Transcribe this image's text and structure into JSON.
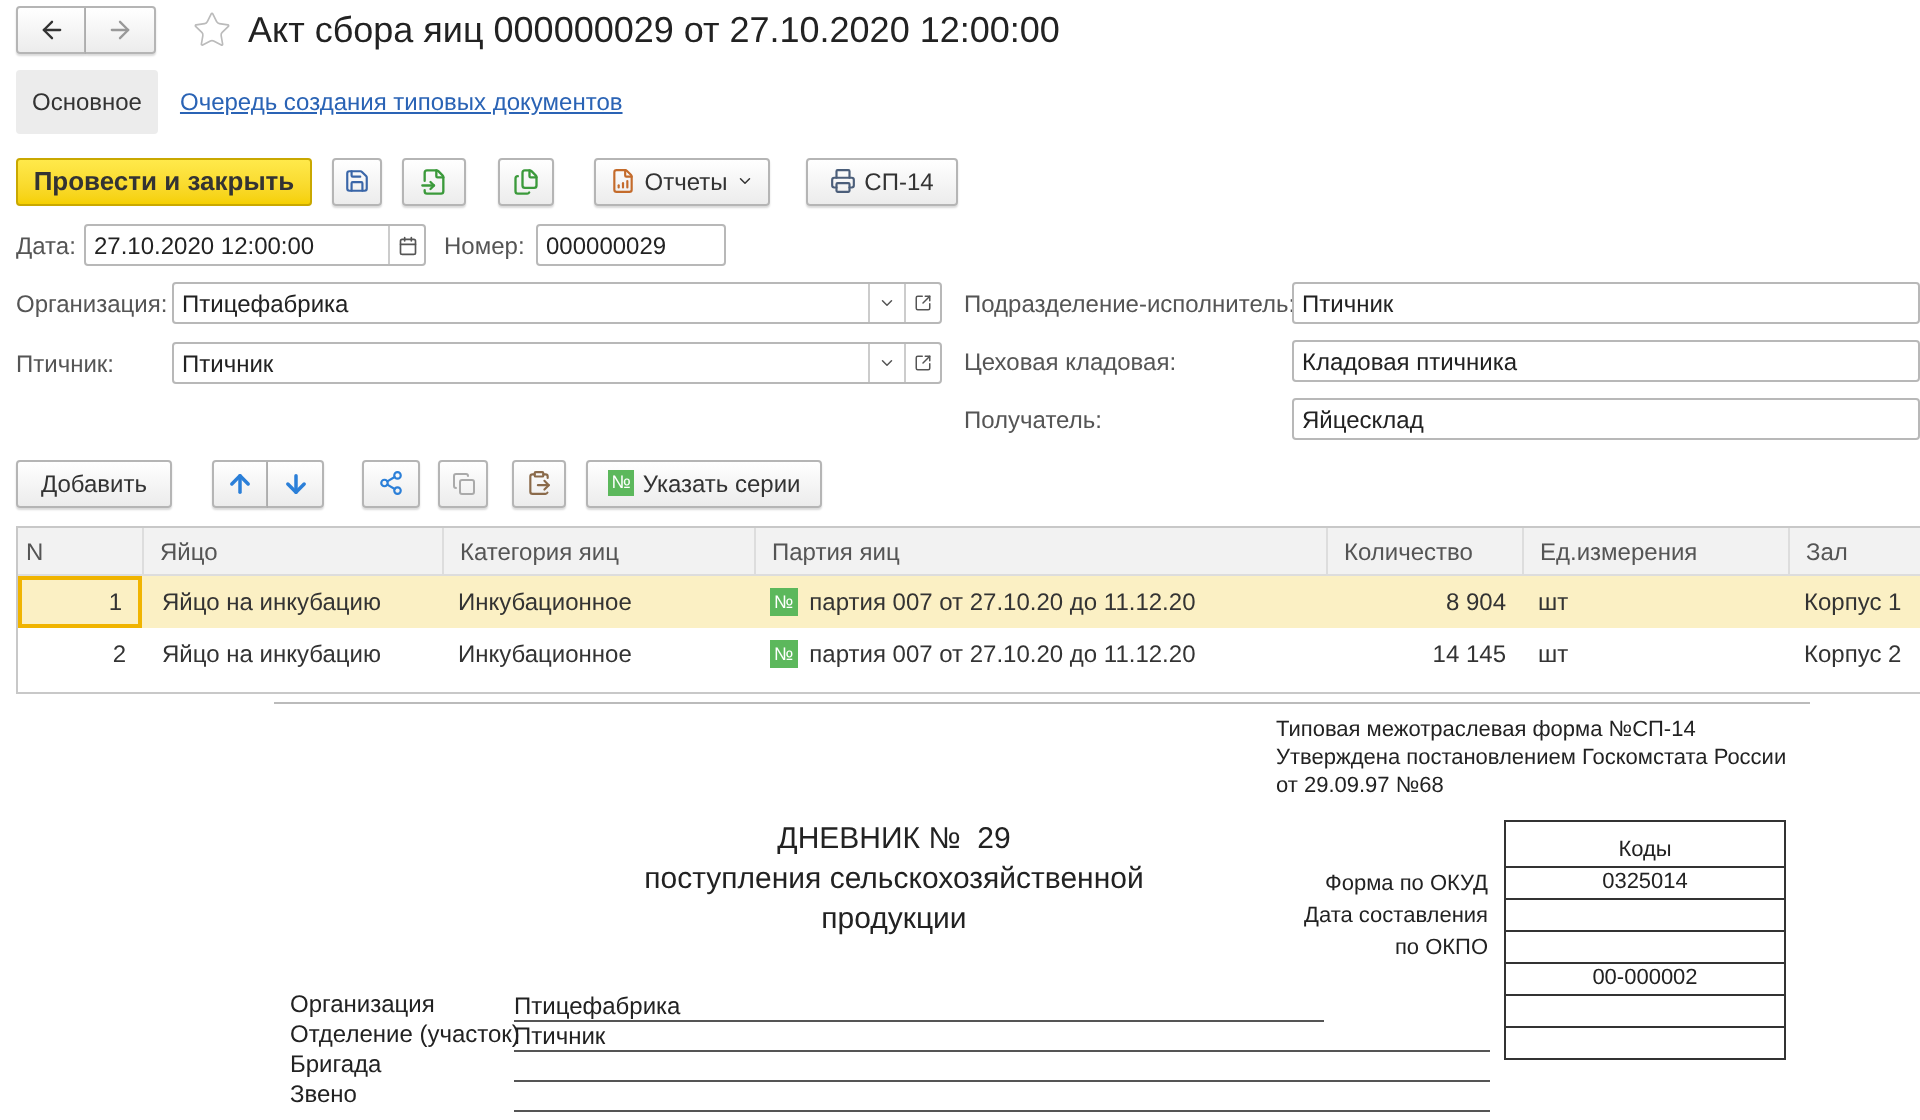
{
  "title": "Акт сбора яиц 000000029 от 27.10.2020 12:00:00",
  "tabs": [
    {
      "label": "Основное",
      "selected": true
    },
    {
      "label": "Очередь создания типовых документов",
      "selected": false
    }
  ],
  "toolbar": {
    "primary": "Провести и закрыть",
    "reports": "Отчеты",
    "print": "СП-14"
  },
  "date": {
    "label": "Дата:",
    "value": "27.10.2020 12:00:00"
  },
  "number": {
    "label": "Номер:",
    "value": "000000029"
  },
  "left_fields": [
    {
      "label": "Организация:",
      "value": "Птицефабрика"
    },
    {
      "label": "Птичник:",
      "value": "Птичник"
    }
  ],
  "right_fields": [
    {
      "label": "Подразделение-исполнитель:",
      "value": "Птичник"
    },
    {
      "label": "Цеховая кладовая:",
      "value": "Кладовая птичника"
    },
    {
      "label": "Получатель:",
      "value": "Яйцесклад"
    }
  ],
  "table_toolbar": {
    "add": "Добавить",
    "series_badge": "№",
    "series": "Указать серии"
  },
  "table": {
    "columns": [
      "N",
      "Яйцо",
      "Категория яиц",
      "Партия яиц",
      "Количество",
      "Ед.измерения",
      "Зал"
    ],
    "rows": [
      {
        "selected": true,
        "n": "1",
        "egg": "Яйцо на инкубацию",
        "category": "Инкубационное",
        "badge": "№",
        "batch": "партия 007 от 27.10.20 до 11.12.20",
        "qty": "8 904",
        "unit": "шт",
        "hall": "Корпус 1"
      },
      {
        "selected": false,
        "n": "2",
        "egg": "Яйцо на инкубацию",
        "category": "Инкубационное",
        "badge": "№",
        "batch": "партия 007 от 27.10.20 до 11.12.20",
        "qty": "14 145",
        "unit": "шт",
        "hall": "Корпус 2"
      }
    ]
  },
  "report": {
    "header_lines": [
      "Типовая межотраслевая форма №СП-14",
      "Утверждена постановлением Госкомстата России",
      "от 29.09.97 №68"
    ],
    "title": "ДНЕВНИК №  29",
    "subtitle_lines": [
      "поступления сельскохозяйственной",
      "продукции"
    ],
    "codes_header": "Коды",
    "code_rows": [
      {
        "label": "Форма по ОКУД",
        "value": "0325014"
      },
      {
        "label": "Дата составления"
      },
      {
        "label": "по ОКПО"
      },
      {
        "value": "00-000002"
      }
    ],
    "org_rows": [
      {
        "label": "Организация",
        "value": "Птицефабрика"
      },
      {
        "label": "Отделение (участок)",
        "value": "Птичник"
      },
      {
        "label": "Бригада"
      },
      {
        "label": "Звено"
      }
    ]
  }
}
